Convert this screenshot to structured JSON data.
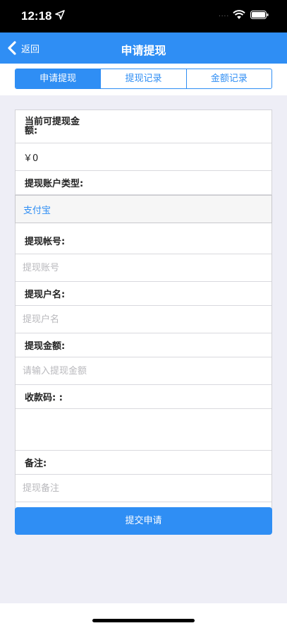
{
  "status_bar": {
    "time": "12:18",
    "signal_dots": "....",
    "icons": [
      "location-arrow-icon",
      "wifi-icon",
      "battery-icon"
    ]
  },
  "nav": {
    "back_label": "返回",
    "title": "申请提现"
  },
  "tabs": [
    {
      "label": "申请提现",
      "active": true
    },
    {
      "label": "提现记录",
      "active": false
    },
    {
      "label": "金额记录",
      "active": false
    }
  ],
  "form": {
    "amount_label": "当前可提现金额:",
    "amount_value": "￥0",
    "account_type_label": "提现账户类型:",
    "account_type_value": "支付宝",
    "account_no_label": "提现帐号:",
    "account_no_placeholder": "提现账号",
    "account_name_label": "提现户名:",
    "account_name_placeholder": "提现户名",
    "withdraw_amount_label": "提现金额:",
    "withdraw_amount_placeholder": "请输入提现金额",
    "qr_label": "收款码: :",
    "remark_label": "备注:",
    "remark_placeholder": "提现备注"
  },
  "submit_label": "提交申请",
  "colors": {
    "accent": "#2f8ef4",
    "background": "#eeeef6",
    "select_text": "#2f8ef4"
  }
}
